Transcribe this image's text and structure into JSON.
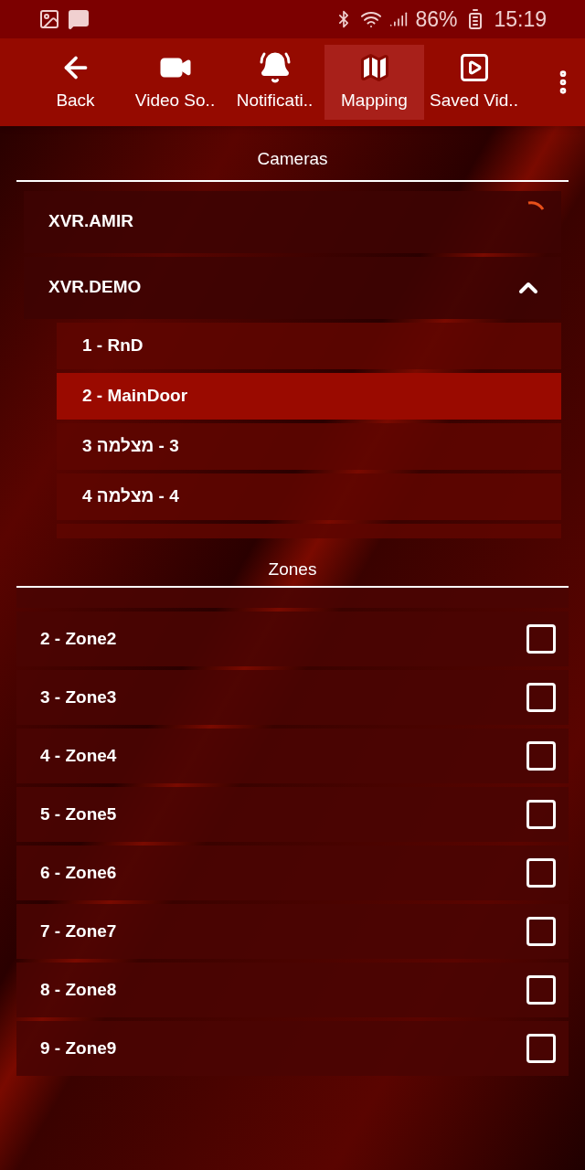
{
  "status_bar": {
    "battery": "86%",
    "time": "15:19"
  },
  "toolbar": [
    {
      "label": "Back",
      "kind": "back",
      "selected": false
    },
    {
      "label": "Video So..",
      "kind": "video",
      "selected": false
    },
    {
      "label": "Notificati..",
      "kind": "bell",
      "selected": false
    },
    {
      "label": "Mapping",
      "kind": "map",
      "selected": true
    },
    {
      "label": "Saved Vid..",
      "kind": "saved",
      "selected": false
    }
  ],
  "cameras": {
    "title": "Cameras",
    "groups": [
      {
        "name": "XVR.AMIR",
        "loading": true,
        "expanded": false
      },
      {
        "name": "XVR.DEMO",
        "loading": false,
        "expanded": true,
        "children": [
          {
            "name": "1 - RnD",
            "selected": false
          },
          {
            "name": "2 - MainDoor",
            "selected": true
          },
          {
            "name": "3 - מצלמה 3",
            "selected": false
          },
          {
            "name": "4 - מצלמה 4",
            "selected": false
          }
        ]
      }
    ]
  },
  "zones": {
    "title": "Zones",
    "items": [
      {
        "name": "2 - Zone2",
        "checked": false
      },
      {
        "name": "3 - Zone3",
        "checked": false
      },
      {
        "name": "4 - Zone4",
        "checked": false
      },
      {
        "name": "5 - Zone5",
        "checked": false
      },
      {
        "name": "6 - Zone6",
        "checked": false
      },
      {
        "name": "7 - Zone7",
        "checked": false
      },
      {
        "name": "8 - Zone8",
        "checked": false
      },
      {
        "name": "9 - Zone9",
        "checked": false
      }
    ]
  }
}
